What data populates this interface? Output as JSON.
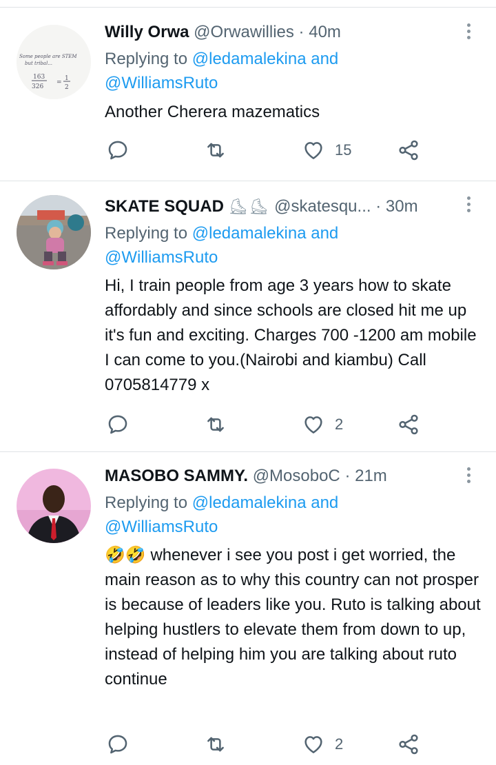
{
  "colors": {
    "mention": "#1d9bf0",
    "secondary": "#536471",
    "text": "#0f1419",
    "divider": "#dfe3e6"
  },
  "tweets": [
    {
      "name": "Willy Orwa",
      "name_emoji": "",
      "handle": "@Orwawillies",
      "time": "40m",
      "replying_prefix": "Replying to",
      "mention1": "@ledamalekina",
      "and": "and",
      "mention2": "@WilliamsRuto",
      "text": "Another Cherera mazematics",
      "emoji_prefix": "",
      "likes": "15",
      "avatar_text": [
        "Some people are STEM",
        "but tribal...",
        "163",
        "326",
        "= 1",
        "2"
      ]
    },
    {
      "name": "SKATE SQUAD",
      "name_emoji": "⛸⛸",
      "handle": "@skatesqu...",
      "time": "30m",
      "replying_prefix": "Replying to",
      "mention1": "@ledamalekina",
      "and": "and",
      "mention2": "@WilliamsRuto",
      "text": "Hi, I train people from age 3 years how to skate affordably and since schools are closed hit me up it's fun and exciting. Charges 700 -1200 am mobile I can come to you.(Nairobi and kiambu) Call 0705814779 x",
      "emoji_prefix": "",
      "likes": "2"
    },
    {
      "name": "MASOBO SAMMY.",
      "name_emoji": "",
      "handle": "@MosoboC",
      "time": "21m",
      "replying_prefix": "Replying to",
      "mention1": "@ledamalekina",
      "and": "and",
      "mention2": "@WilliamsRuto",
      "text": "whenever i see you post i get worried, the main reason as to why this country can not prosper is because of leaders like you. Ruto is talking about helping hustlers to elevate them from down to up, instead of helping him you are talking about ruto continue",
      "emoji_prefix": "🤣🤣",
      "likes": "2"
    }
  ],
  "icons": {
    "reply": "reply-bubble-icon",
    "retweet": "retweet-icon",
    "like": "heart-icon",
    "share": "share-icon",
    "more": "more-vertical-icon"
  }
}
